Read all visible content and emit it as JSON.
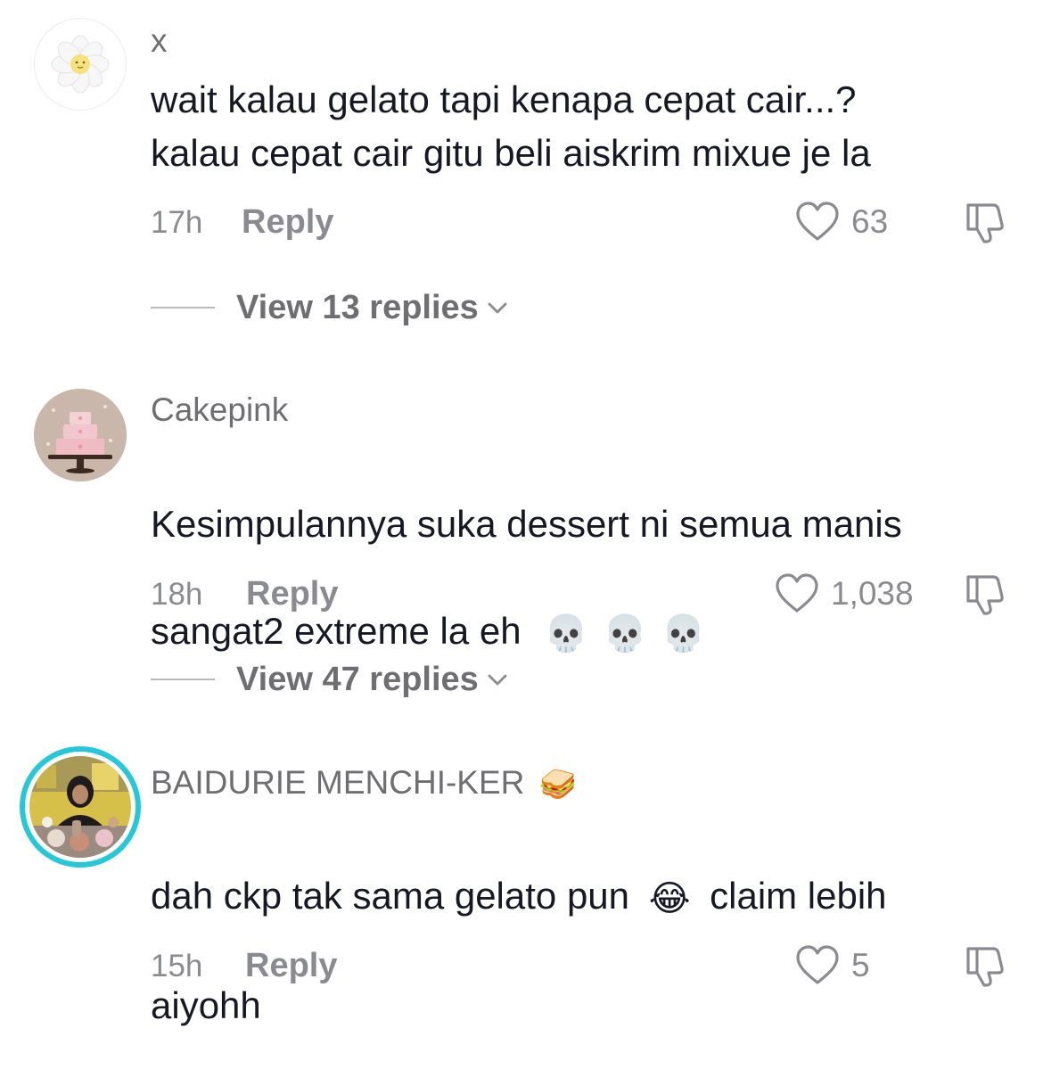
{
  "comments": [
    {
      "username": "x",
      "text": "wait kalau gelato tapi kenapa cepat cair...?\nkalau cepat cair gitu beli aiskrim mixue je la",
      "time": "17h",
      "reply_label": "Reply",
      "likes": "63",
      "view_replies": "View 13 replies",
      "avatar_icon": "daisy-flower-avatar"
    },
    {
      "username": "Cakepink",
      "text_line1": "Kesimpulannya suka dessert ni semua manis",
      "text_line2": "sangat2 extreme la eh",
      "text_emoji": "💀💀💀",
      "time": "18h",
      "reply_label": "Reply",
      "likes": "1,038",
      "view_replies": "View 47 replies",
      "avatar_icon": "pink-cake-avatar"
    },
    {
      "username": "BAIDURIE MENCHI-KER",
      "username_emoji": "🥪",
      "text_part1": "dah ckp tak sama gelato pun",
      "text_emoji": "😂",
      "text_part2": "claim lebih",
      "text_line2": "aiyohh",
      "time": "15h",
      "reply_label": "Reply",
      "likes": "5",
      "avatar_icon": "user-photo-avatar"
    }
  ],
  "colors": {
    "primary_text": "#161823",
    "secondary_text": "#8a8b91",
    "username_text": "#6f6f73",
    "story_ring": "#25c8d8"
  }
}
